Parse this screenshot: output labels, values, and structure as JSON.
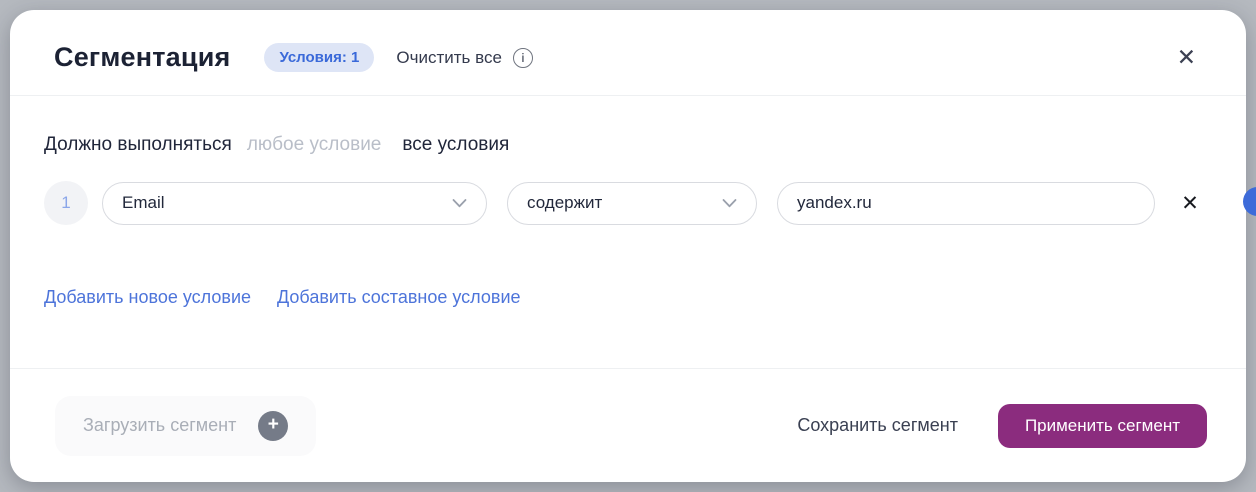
{
  "modal": {
    "header": {
      "title": "Сегментация",
      "conditions_badge": "Условия: 1",
      "clear_all_label": "Очистить все"
    },
    "body": {
      "match_label": "Должно выполняться",
      "match_option_any": "любое условие",
      "match_option_all": "все условия",
      "condition": {
        "index": "1",
        "field_value": "Email",
        "operator_value": "содержит",
        "value": "yandex.ru"
      },
      "add_condition_label": "Добавить новое условие",
      "add_compound_condition_label": "Добавить составное условие"
    },
    "footer": {
      "load_segment_label": "Загрузить сегмент",
      "save_segment_label": "Сохранить сегмент",
      "apply_segment_label": "Применить сегмент"
    }
  },
  "icons": {
    "info": "i",
    "close": "✕",
    "remove": "✕",
    "plus": "+"
  },
  "colors": {
    "accent_purple": "#8b2c7e",
    "link_blue": "#4d74da",
    "badge_bg": "#dee5f6",
    "badge_text": "#3a69d9",
    "edge_circle_blue": "#3d6bd9",
    "page_background": "#b5b9bf"
  }
}
